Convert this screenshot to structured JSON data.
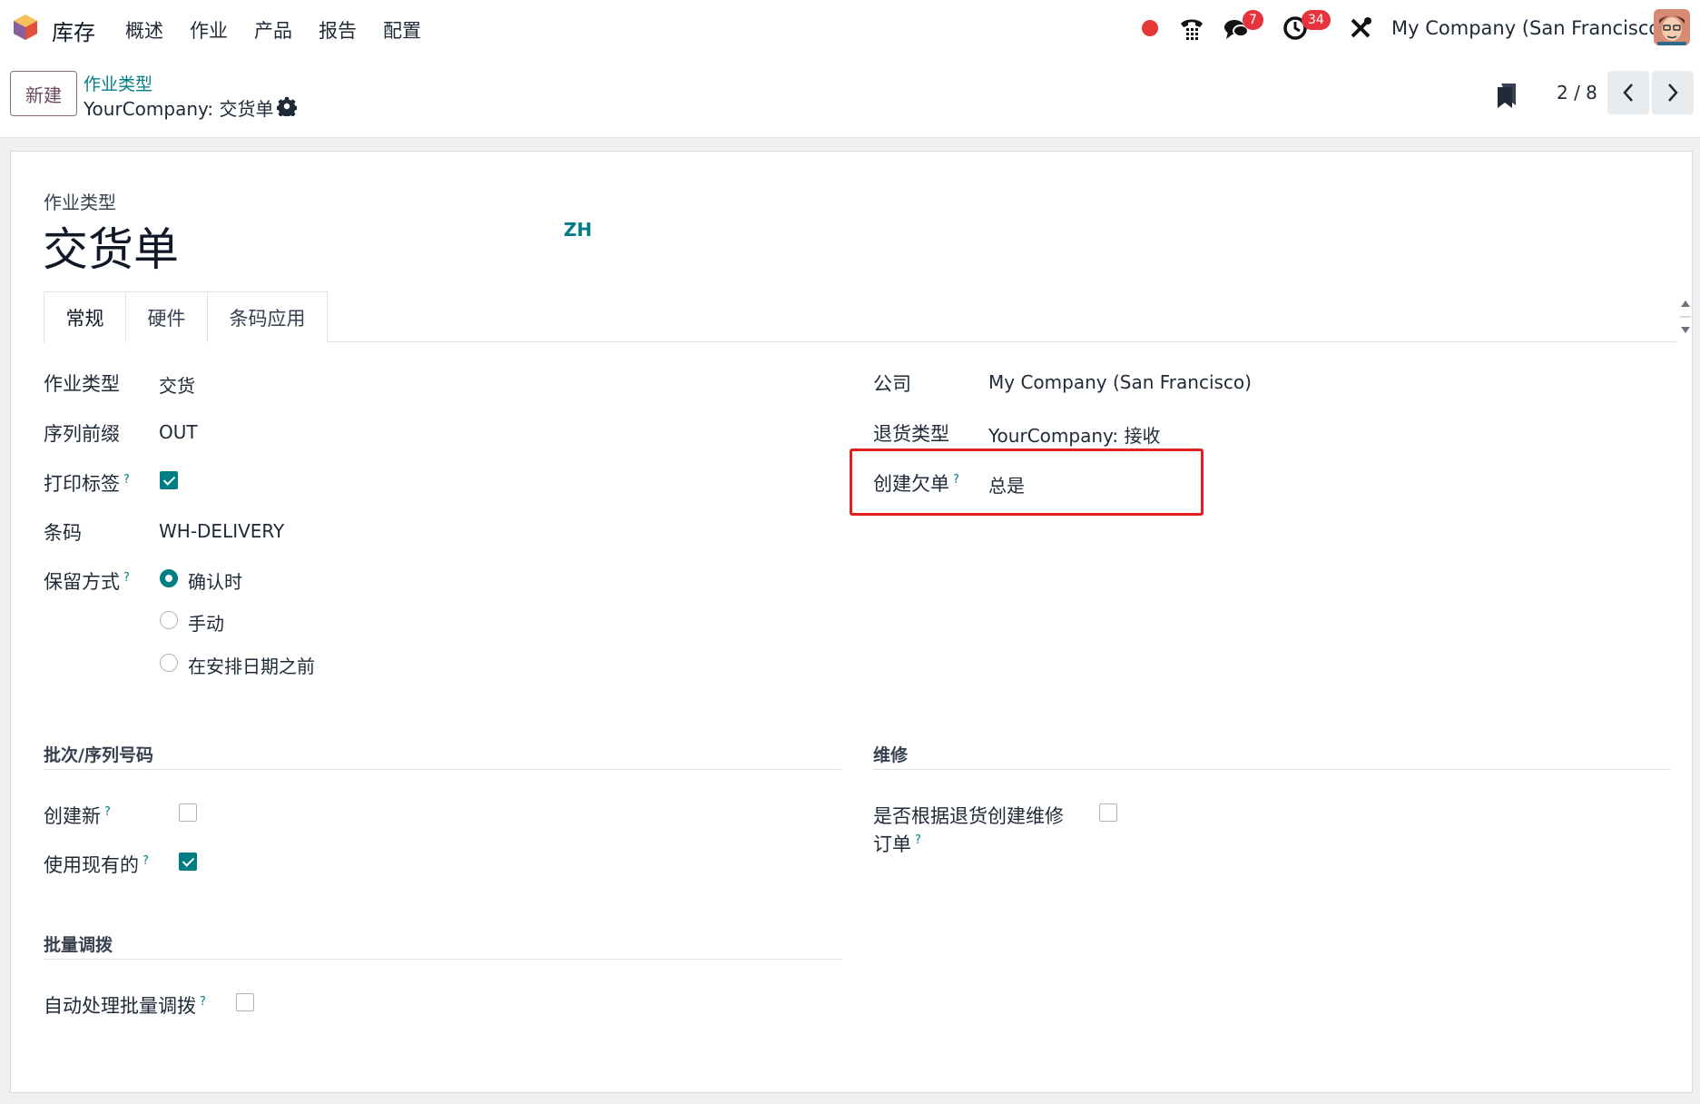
{
  "navbar": {
    "app_name": "库存",
    "menu": [
      "概述",
      "作业",
      "产品",
      "报告",
      "配置"
    ],
    "messages_badge": "7",
    "activities_badge": "34",
    "company": "My Company (San Francisco)"
  },
  "control_panel": {
    "new_button": "新建",
    "breadcrumb_parent": "作业类型",
    "breadcrumb_current": "YourCompany: 交货单",
    "pager": "2 / 8"
  },
  "form": {
    "caption": "作业类型",
    "title": "交货单",
    "lang_code": "ZH",
    "tabs": [
      "常规",
      "硬件",
      "条码应用"
    ],
    "left_fields": {
      "operation_type_label": "作业类型",
      "operation_type_value": "交货",
      "sequence_prefix_label": "序列前缀",
      "sequence_prefix_value": "OUT",
      "print_label_label": "打印标签",
      "print_label_checked": true,
      "barcode_label": "条码",
      "barcode_value": "WH-DELIVERY",
      "reservation_label": "保留方式",
      "reservation_options": [
        "确认时",
        "手动",
        "在安排日期之前"
      ],
      "reservation_selected": "确认时"
    },
    "right_fields": {
      "company_label": "公司",
      "company_value": "My Company (San Francisco)",
      "return_type_label": "退货类型",
      "return_type_value": "YourCompany: 接收",
      "backorder_label": "创建欠单",
      "backorder_value": "总是"
    },
    "lots_section": {
      "title": "批次/序列号码",
      "create_new_label": "创建新",
      "create_new_checked": false,
      "use_existing_label": "使用现有的",
      "use_existing_checked": true
    },
    "repair_section": {
      "title": "维修",
      "create_repair_label_line1": "是否根据退货创建维修",
      "create_repair_label_line2": "订单",
      "create_repair_checked": false
    },
    "batch_section": {
      "title": "批量调拨",
      "auto_batch_label": "自动处理批量调拨",
      "auto_batch_checked": false
    },
    "help_mark": "?"
  },
  "colors": {
    "accent": "#017e84",
    "brand": "#714b67",
    "highlight": "#e32020",
    "badge": "#e5343d"
  },
  "icons": [
    "app-logo-icon",
    "record-icon",
    "phone-icon",
    "chat-icon",
    "clock-icon",
    "tools-icon",
    "gear-icon",
    "bookmark-icon",
    "chevron-left-icon",
    "chevron-right-icon"
  ]
}
